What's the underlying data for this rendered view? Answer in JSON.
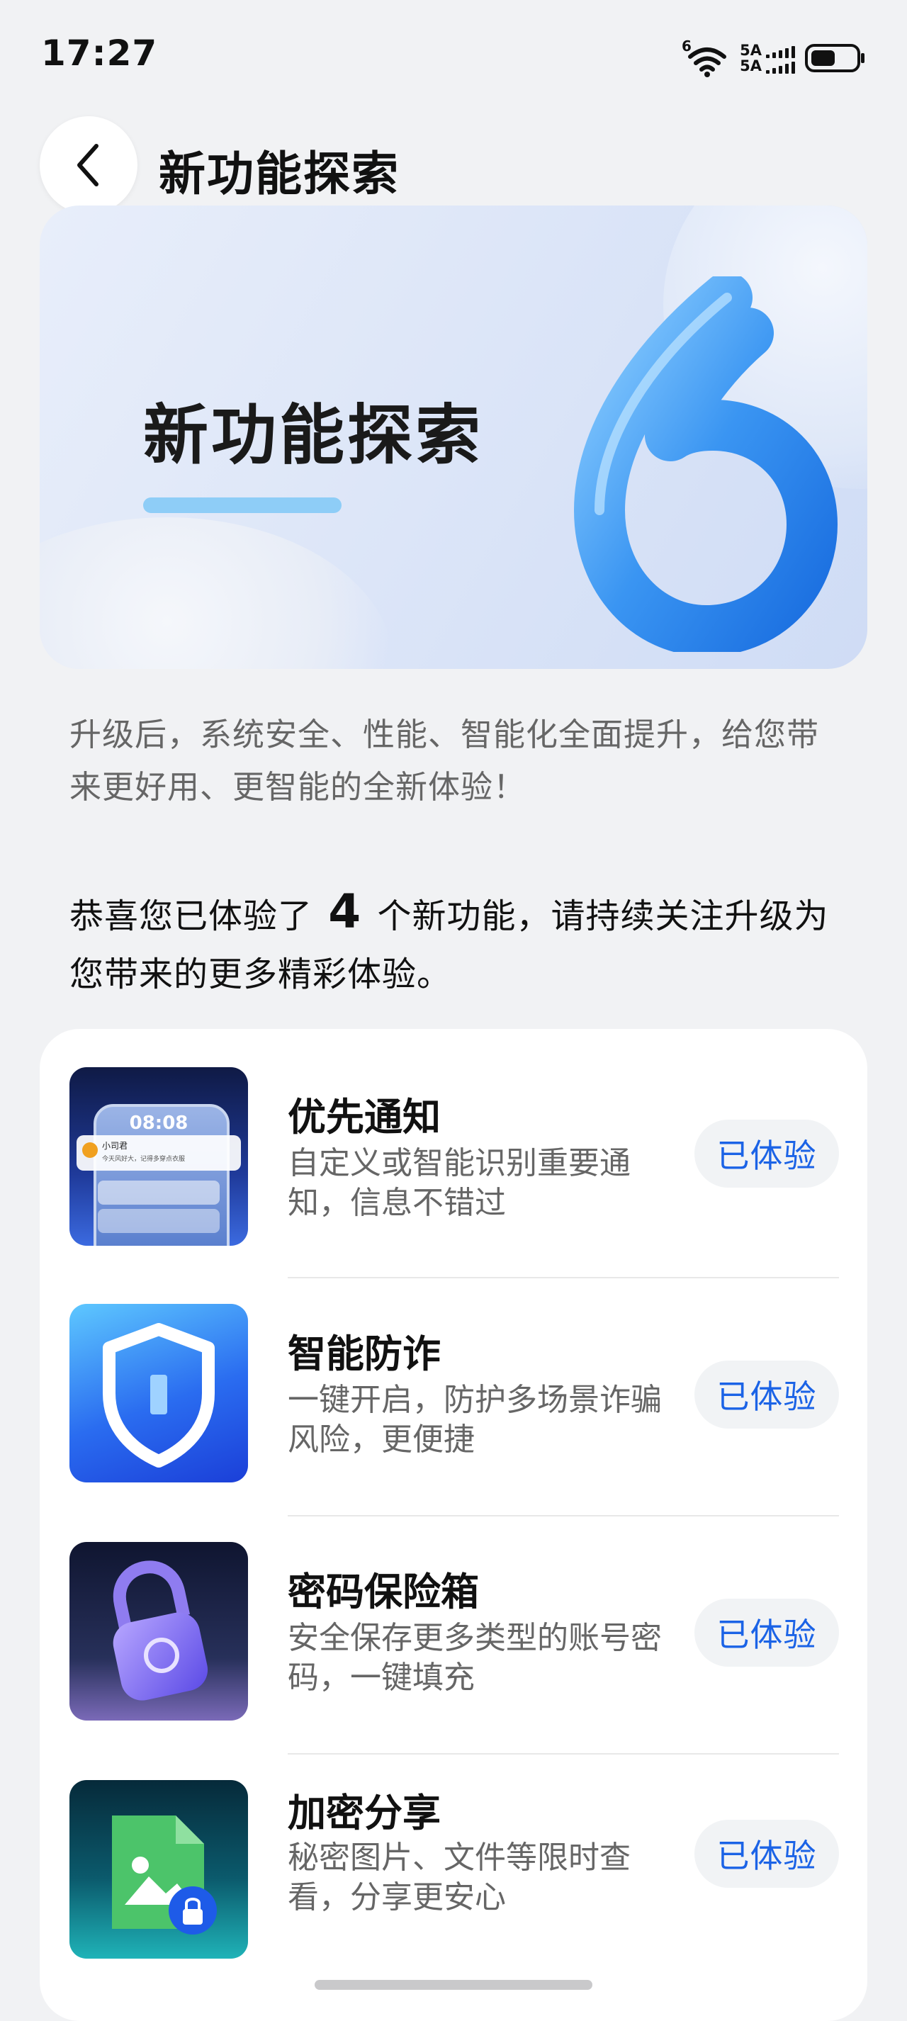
{
  "status_bar": {
    "time": "17:27",
    "wifi_label": "6",
    "sim1_label": "5A",
    "sim2_label": "5A",
    "icons": [
      "wifi-icon",
      "signal-icon",
      "battery-icon"
    ]
  },
  "header": {
    "back_icon": "chevron-left-icon",
    "title": "新功能探索"
  },
  "banner": {
    "title": "新功能探索",
    "badge_number": "6"
  },
  "intro": {
    "text": "升级后，系统安全、性能、智能化全面提升，给您带来更好用、更智能的全新体验！"
  },
  "progress": {
    "prefix": "恭喜您已体验了",
    "count": "4",
    "suffix": "个新功能，请持续关注升级为您带来的更多精彩体验。"
  },
  "features": [
    {
      "name": "优先通知",
      "description": "自定义或智能识别重要通知，信息不错过",
      "button": "已体验",
      "thumb_time": "08:08",
      "thumb_sender": "小司君",
      "thumb_message": "今天风好大，记得多穿点衣服"
    },
    {
      "name": "智能防诈",
      "description": "一键开启，防护多场景诈骗风险，更便捷",
      "button": "已体验"
    },
    {
      "name": "密码保险箱",
      "description": "安全保存更多类型的账号密码，一键填充",
      "button": "已体验"
    },
    {
      "name": "加密分享",
      "description": "秘密图片、文件等限时查看，分享更安心",
      "button": "已体验"
    }
  ],
  "colors": {
    "background": "#f1f2f4",
    "accent_blue": "#1b63e6",
    "button_bg": "#f1f3f5"
  }
}
